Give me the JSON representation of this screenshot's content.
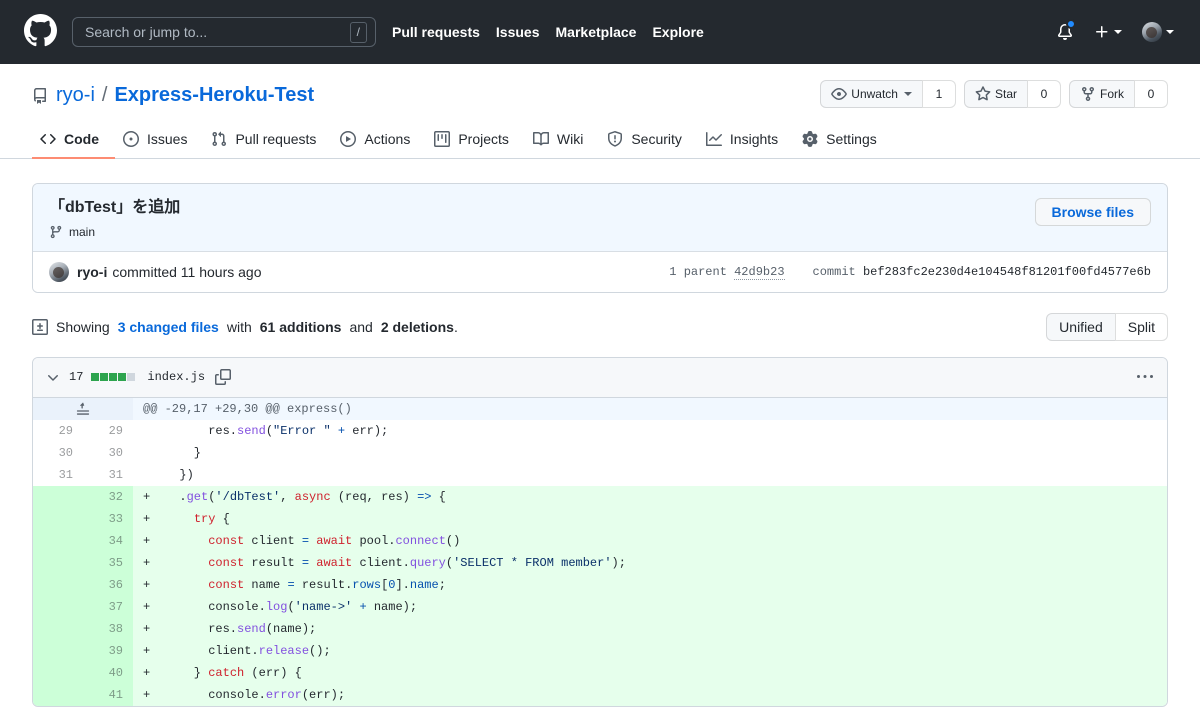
{
  "header": {
    "logo_icon": "github-mark-icon",
    "search": {
      "placeholder": "Search or jump to...",
      "shortcut_key": "/"
    },
    "nav": [
      {
        "label": "Pull requests"
      },
      {
        "label": "Issues"
      },
      {
        "label": "Marketplace"
      },
      {
        "label": "Explore"
      }
    ],
    "notifications_icon": "bell-icon",
    "has_unread_notifications": true,
    "create_new_icon": "plus-icon",
    "account_icon": "avatar-icon"
  },
  "repo": {
    "icon": "repo-icon",
    "owner": "ryo-i",
    "separator": "/",
    "name": "Express-Heroku-Test",
    "actions": [
      {
        "label": "Unwatch",
        "icon": "eye-icon",
        "count": "1",
        "has_caret": true
      },
      {
        "label": "Star",
        "icon": "star-icon",
        "count": "0",
        "has_caret": false
      },
      {
        "label": "Fork",
        "icon": "fork-icon",
        "count": "0",
        "has_caret": false
      }
    ],
    "tabs": [
      {
        "label": "Code",
        "icon": "code-icon",
        "active": true
      },
      {
        "label": "Issues",
        "icon": "issue-opened-icon",
        "active": false
      },
      {
        "label": "Pull requests",
        "icon": "git-pull-request-icon",
        "active": false
      },
      {
        "label": "Actions",
        "icon": "play-icon",
        "active": false
      },
      {
        "label": "Projects",
        "icon": "project-icon",
        "active": false
      },
      {
        "label": "Wiki",
        "icon": "book-icon",
        "active": false
      },
      {
        "label": "Security",
        "icon": "shield-icon",
        "active": false
      },
      {
        "label": "Insights",
        "icon": "graph-icon",
        "active": false
      },
      {
        "label": "Settings",
        "icon": "gear-icon",
        "active": false
      }
    ]
  },
  "commit": {
    "title": "「dbTest」を追加",
    "branch_icon": "git-branch-icon",
    "branch": "main",
    "browse_files_label": "Browse files",
    "author": "ryo-i",
    "committed_text": "committed 11 hours ago",
    "parent_label": "1 parent",
    "parent_sha": "42d9b23",
    "commit_label": "commit",
    "commit_sha": "bef283fc2e230d4e104548f81201f00fd4577e6b"
  },
  "diff_summary": {
    "icon": "diff-icon",
    "prefix": "Showing",
    "changed_files_link": "3 changed files",
    "with_text": "with",
    "additions": "61 additions",
    "and_text": "and",
    "deletions": "2 deletions",
    "suffix": ".",
    "view_unified": "Unified",
    "view_split": "Split",
    "selected_view": "Unified"
  },
  "file": {
    "chevron_icon": "chevron-down-icon",
    "changes": "17",
    "diffstat_blocks": [
      "add",
      "add",
      "add",
      "add",
      "none"
    ],
    "name": "index.js",
    "copy_icon": "copy-icon",
    "menu_icon": "kebab-horizontal-icon",
    "expand_icon": "unfold-up-icon",
    "hunk_header": "@@ -29,17 +29,30 @@ express()",
    "lines": [
      {
        "type": "ctx",
        "old": "29",
        "new": "29",
        "marker": "",
        "text": "      res.send(\"Error \" + err);"
      },
      {
        "type": "ctx",
        "old": "30",
        "new": "30",
        "marker": "",
        "text": "    }"
      },
      {
        "type": "ctx",
        "old": "31",
        "new": "31",
        "marker": "",
        "text": "  })"
      },
      {
        "type": "add",
        "old": "",
        "new": "32",
        "marker": "+",
        "text": "  .get('/dbTest', async (req, res) => {"
      },
      {
        "type": "add",
        "old": "",
        "new": "33",
        "marker": "+",
        "text": "    try {"
      },
      {
        "type": "add",
        "old": "",
        "new": "34",
        "marker": "+",
        "text": "      const client = await pool.connect()"
      },
      {
        "type": "add",
        "old": "",
        "new": "35",
        "marker": "+",
        "text": "      const result = await client.query('SELECT * FROM member');"
      },
      {
        "type": "add",
        "old": "",
        "new": "36",
        "marker": "+",
        "text": "      const name = result.rows[0].name;"
      },
      {
        "type": "add",
        "old": "",
        "new": "37",
        "marker": "+",
        "text": "      console.log('name->' + name);"
      },
      {
        "type": "add",
        "old": "",
        "new": "38",
        "marker": "+",
        "text": "      res.send(name);"
      },
      {
        "type": "add",
        "old": "",
        "new": "39",
        "marker": "+",
        "text": "      client.release();"
      },
      {
        "type": "add",
        "old": "",
        "new": "40",
        "marker": "+",
        "text": "    } catch (err) {"
      },
      {
        "type": "add",
        "old": "",
        "new": "41",
        "marker": "+",
        "text": "      console.error(err);"
      }
    ]
  },
  "colors": {
    "header_bg": "#24292f",
    "link_blue": "#0969da",
    "active_tab_underline": "#fd8c73",
    "addition_bg": "#e6ffec",
    "addition_gutter": "#ccffd8",
    "diffstat_green": "#2da44e",
    "notification_dot": "#218bff"
  }
}
